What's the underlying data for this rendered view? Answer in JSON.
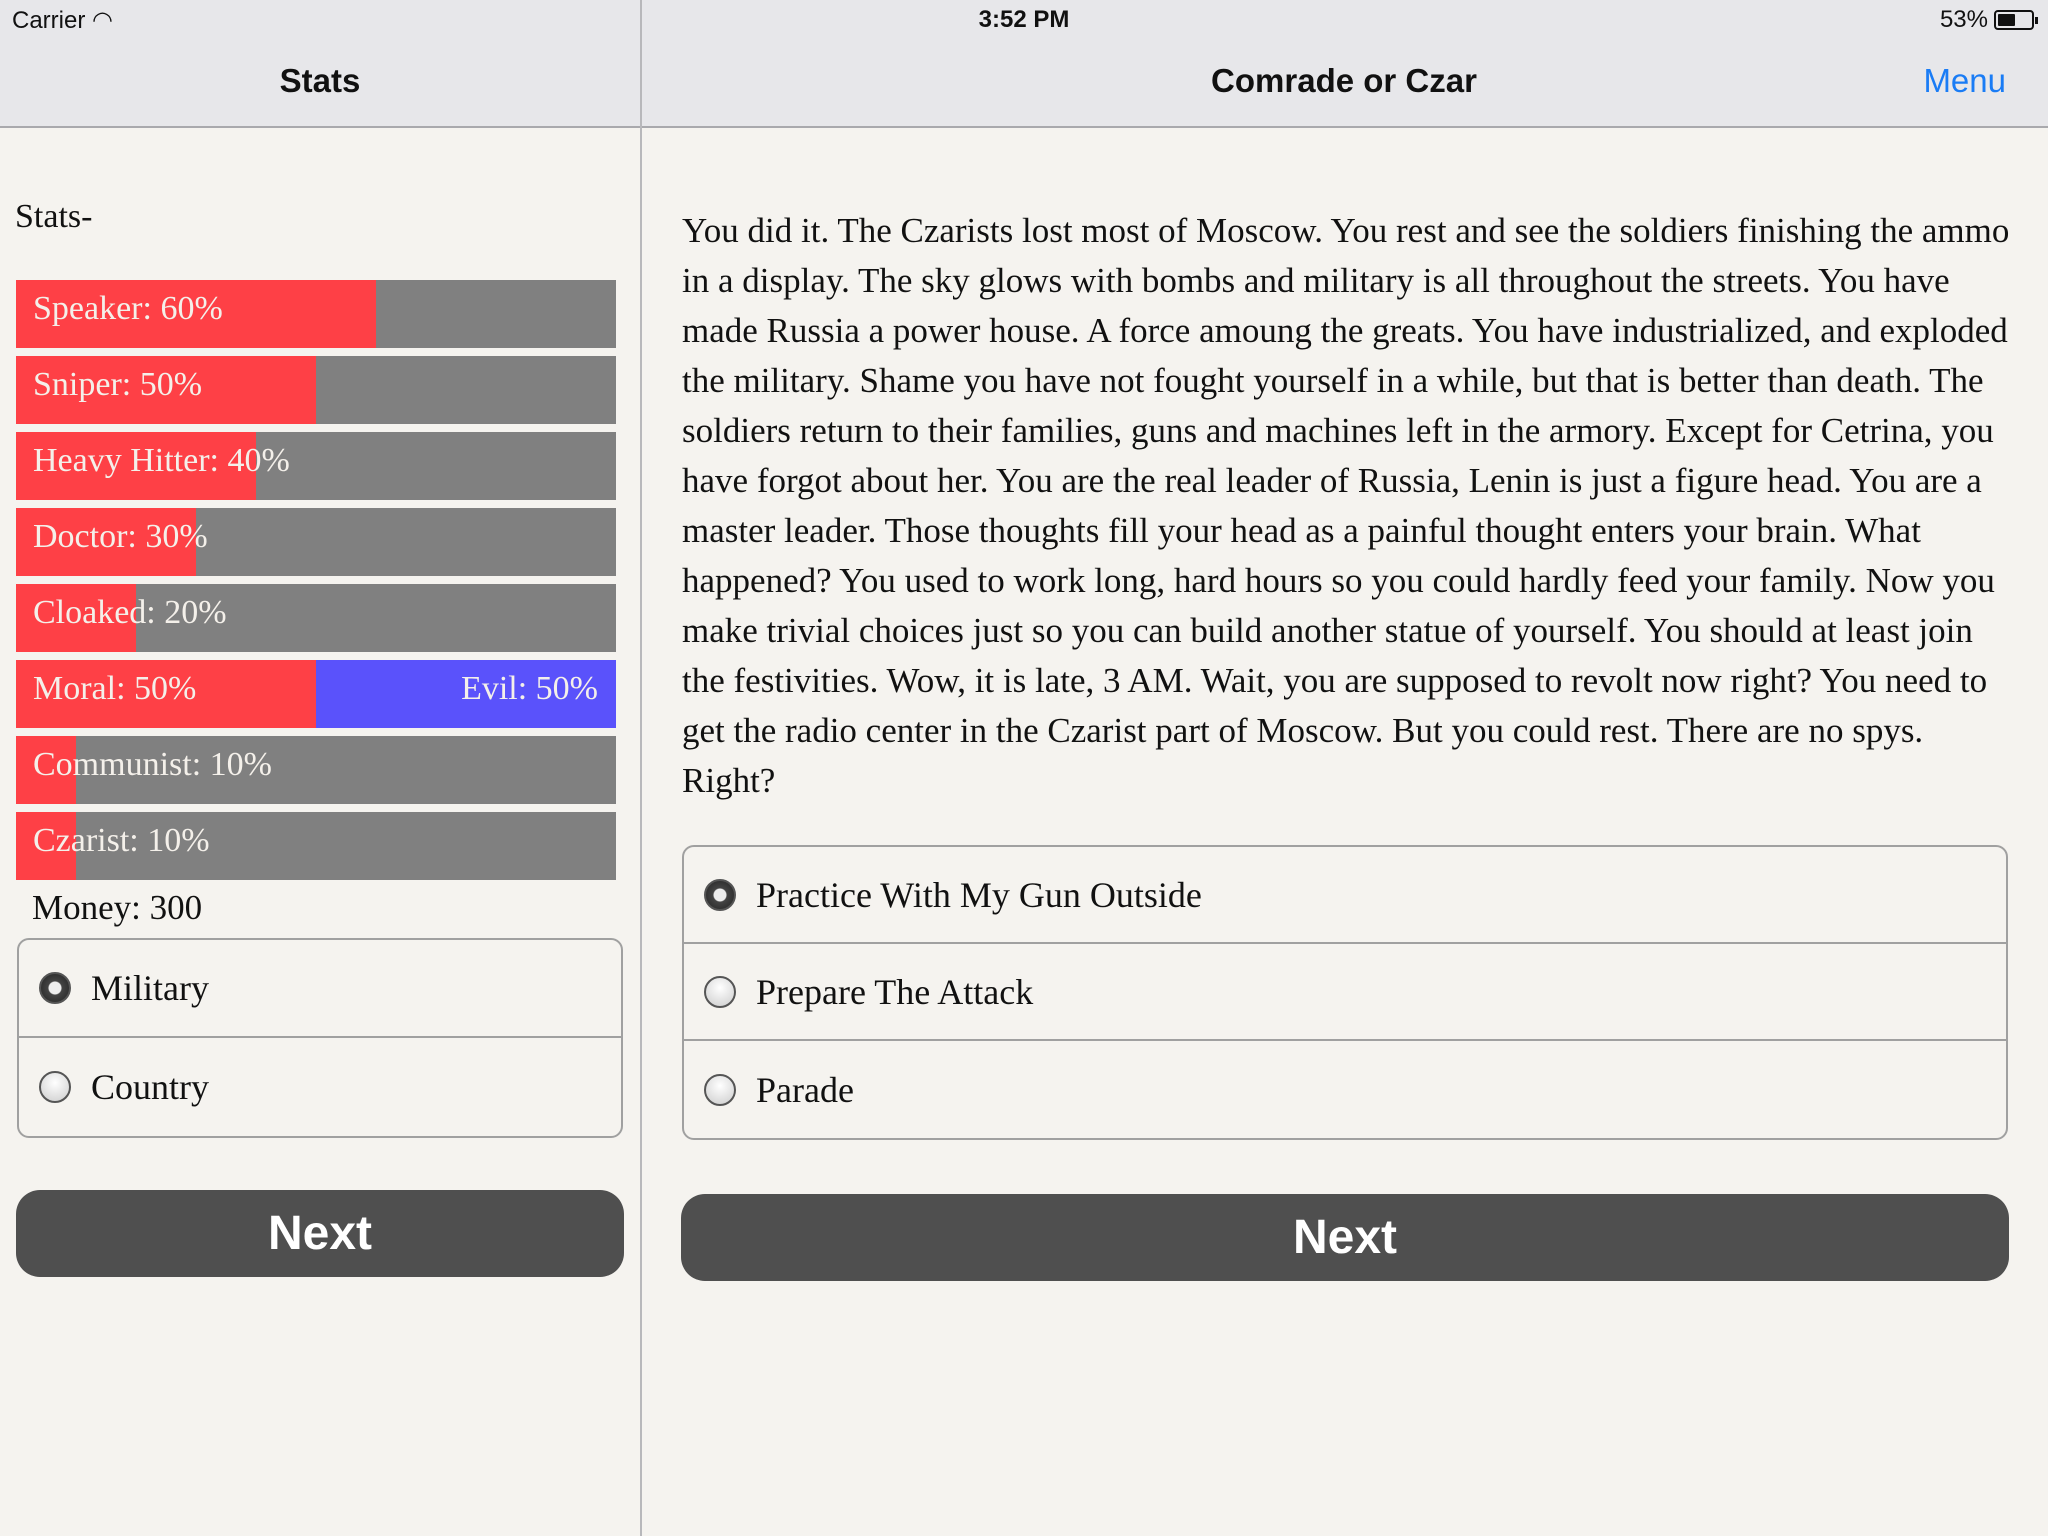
{
  "status": {
    "carrier": "Carrier",
    "time": "3:52 PM",
    "battery": "53%",
    "battery_level": 0.53
  },
  "left": {
    "nav_title": "Stats",
    "heading": "Stats-",
    "bars": [
      {
        "label": "Speaker: 60%",
        "value": 60
      },
      {
        "label": "Sniper: 50%",
        "value": 50
      },
      {
        "label": "Heavy Hitter: 40%",
        "value": 40
      },
      {
        "label": "Doctor: 30%",
        "value": 30
      },
      {
        "label": "Cloaked: 20%",
        "value": 20
      },
      {
        "label": "Moral: 50%",
        "value": 50,
        "right_label": "Evil: 50%"
      },
      {
        "label": "Communist: 10%",
        "value": 10
      },
      {
        "label": "Czarist: 10%",
        "value": 10
      }
    ],
    "money": "Money: 300",
    "options": [
      {
        "label": "Military",
        "selected": true
      },
      {
        "label": "Country",
        "selected": false
      }
    ],
    "next": "Next"
  },
  "right": {
    "nav_title": "Comrade or Czar",
    "menu": "Menu",
    "story": "You did it. The Czarists lost most of Moscow. You rest and see the soldiers finishing the ammo in a display. The sky glows with bombs and military is all throughout the streets. You have made Russia a power house. A force amoung the greats. You have industrialized, and exploded the military. Shame you have not fought yourself in a while, but that is better than death. The soldiers return to their families, guns and machines left in the armory. Except for Cetrina, you have forgot about her. You are the real leader of Russia, Lenin is just a figure head. You are a master leader. Those thoughts fill your head as a painful thought enters your brain. What happened? You used to work long, hard hours so you could hardly feed your family. Now you make trivial choices just so you can build another statue of yourself. You should at least join the festivities. Wow, it is late, 3 AM. Wait, you are supposed to revolt now right? You need to get the radio center in the Czarist part of Moscow. But you could rest. There are no spys. Right?",
    "options": [
      {
        "label": "Practice With My Gun Outside",
        "selected": true
      },
      {
        "label": "Prepare The Attack",
        "selected": false
      },
      {
        "label": "Parade",
        "selected": false
      }
    ],
    "next": "Next"
  },
  "colors": {
    "bar_fill": "#fe4046",
    "bar_track": "#808080",
    "evil": "#5a52fb",
    "accent": "#1a7cf5",
    "button": "#4f4f4f"
  }
}
